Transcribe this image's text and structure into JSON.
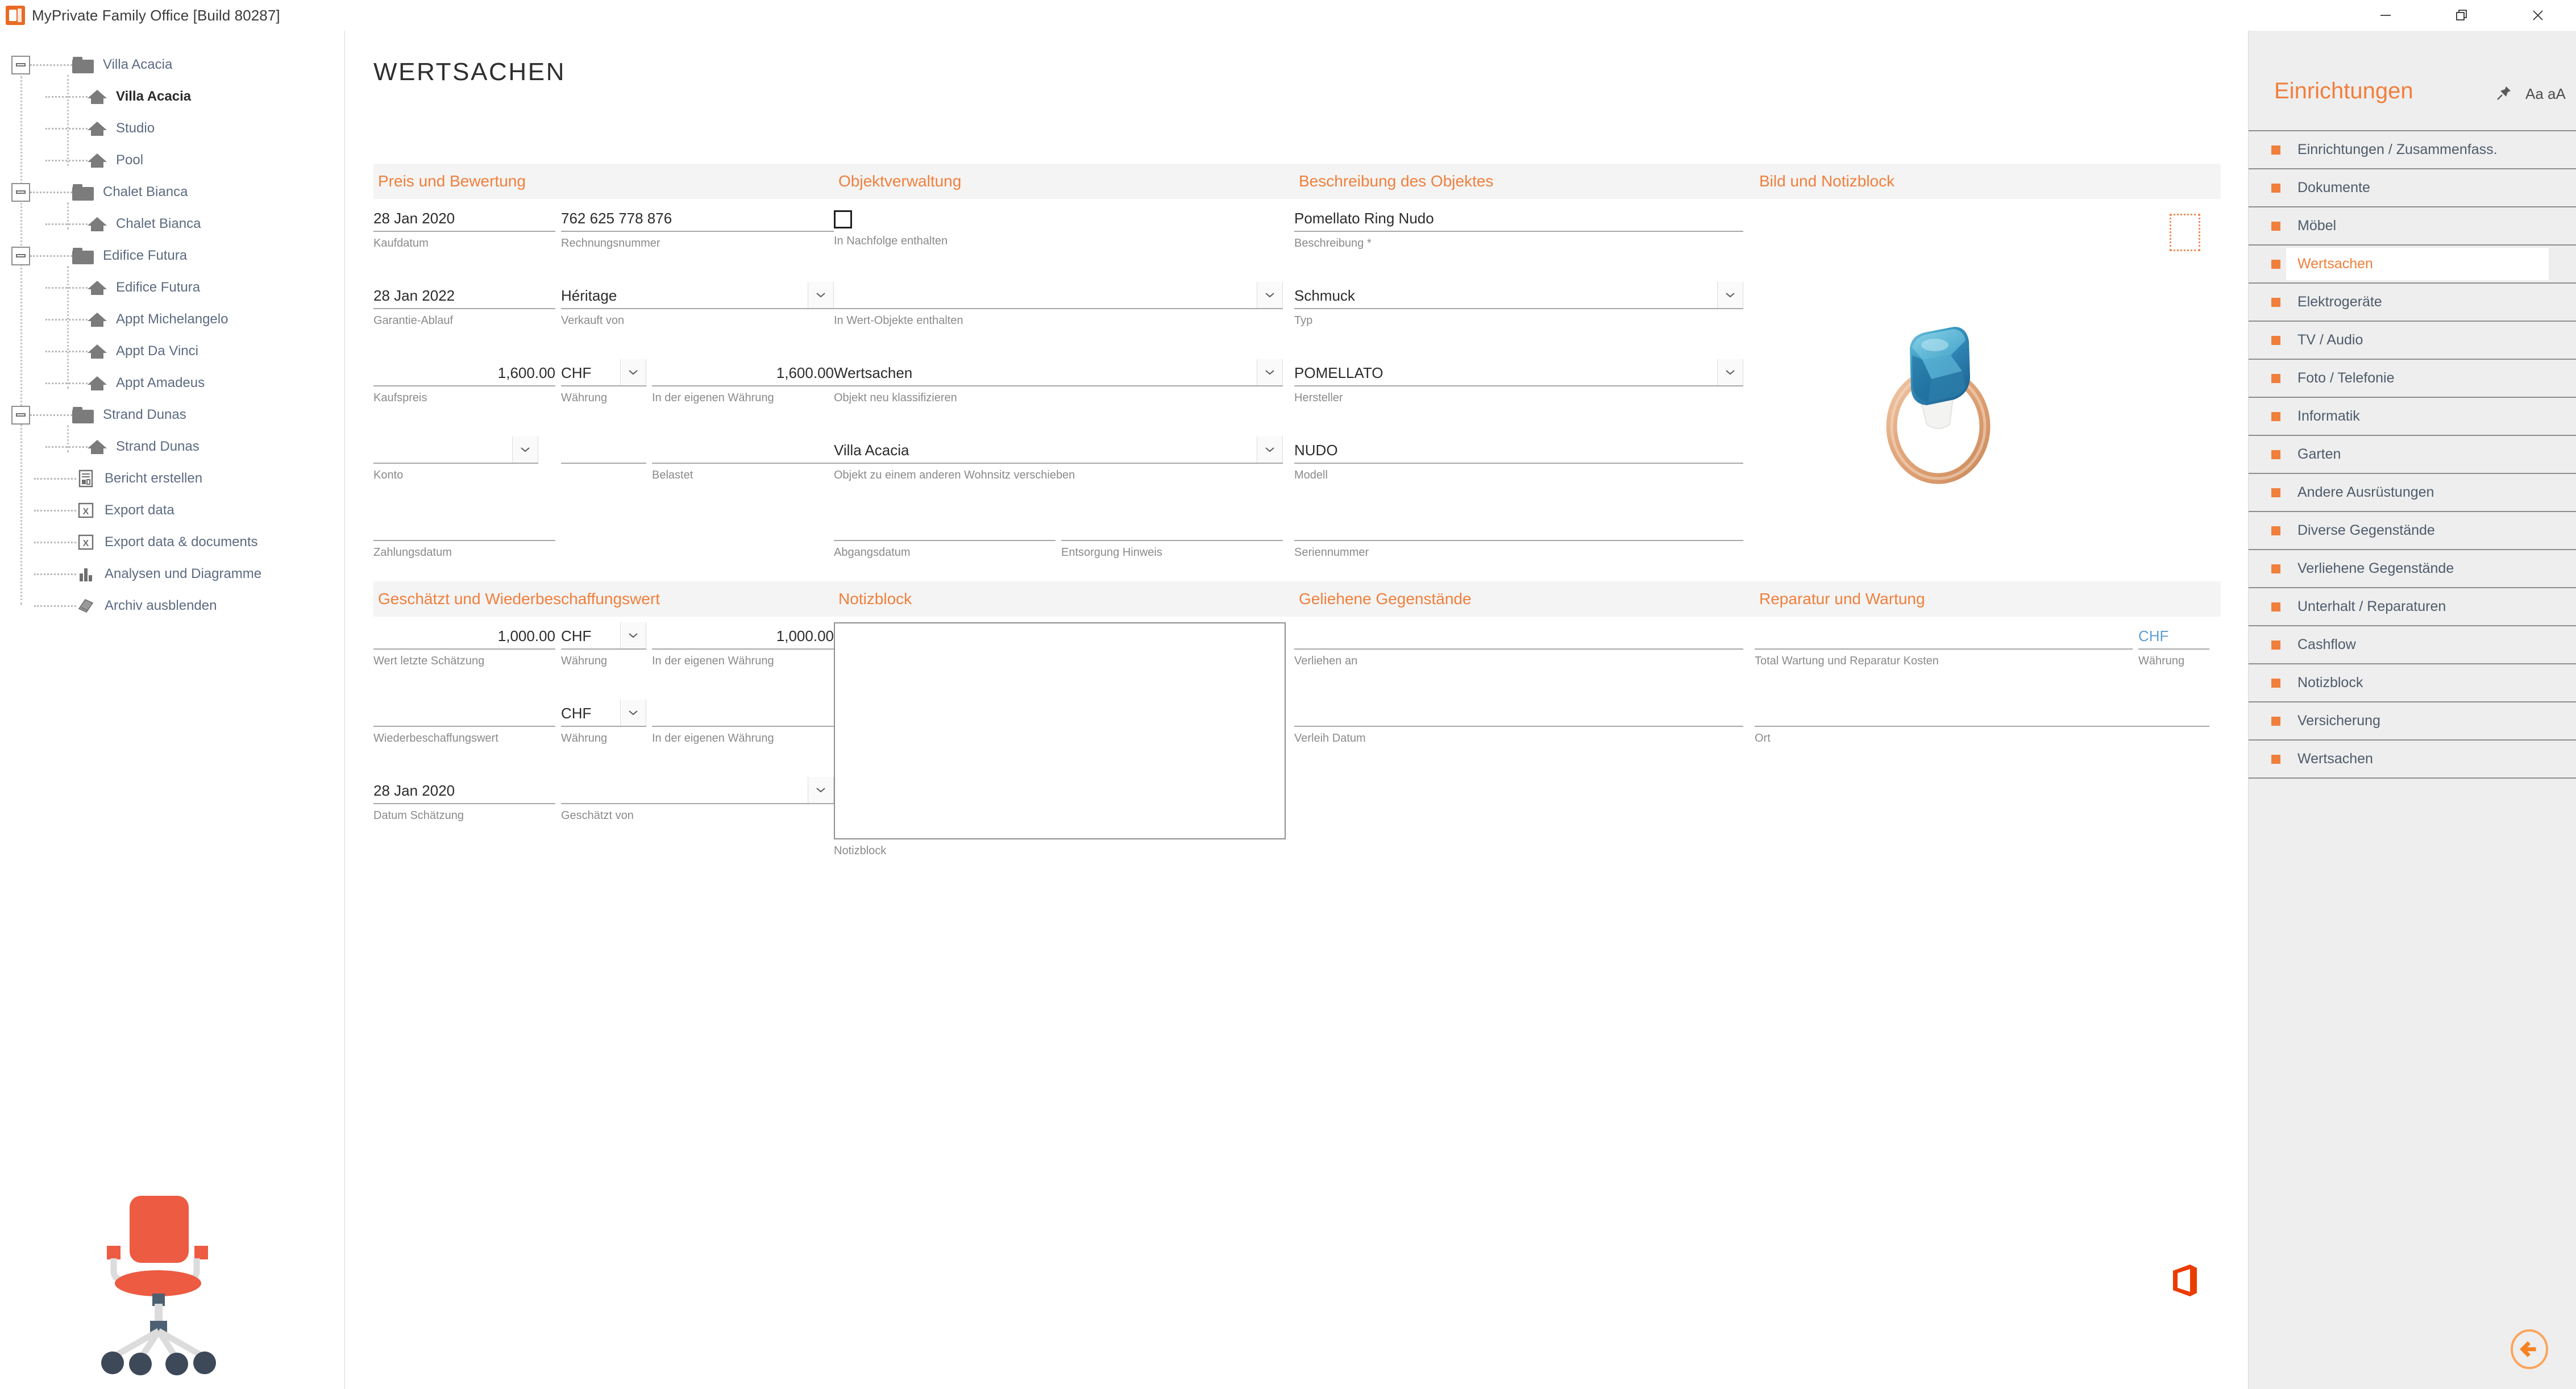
{
  "window": {
    "title": "MyPrivate Family Office [Build 80287]",
    "app_icon": "mp-office-icon",
    "controls": [
      {
        "name": "minimize-button",
        "icon": "minimize-icon"
      },
      {
        "name": "restore-button",
        "icon": "restore-icon"
      },
      {
        "name": "close-button",
        "icon": "close-icon"
      }
    ]
  },
  "sidebar": {
    "groups": [
      {
        "label": "Villa Acacia",
        "icon": "folder-icon",
        "children": [
          {
            "label": "Villa Acacia",
            "icon": "house-icon",
            "selected": true
          },
          {
            "label": "Studio",
            "icon": "house-icon",
            "selected": false
          },
          {
            "label": "Pool",
            "icon": "house-icon",
            "selected": false
          }
        ]
      },
      {
        "label": "Chalet Bianca",
        "icon": "folder-icon",
        "children": [
          {
            "label": "Chalet Bianca",
            "icon": "house-icon",
            "selected": false
          }
        ]
      },
      {
        "label": "Edifice Futura",
        "icon": "folder-icon",
        "children": [
          {
            "label": "Edifice Futura",
            "icon": "house-icon",
            "selected": false
          },
          {
            "label": "Appt Michelangelo",
            "icon": "house-icon",
            "selected": false
          },
          {
            "label": "Appt Da Vinci",
            "icon": "house-icon",
            "selected": false
          },
          {
            "label": "Appt Amadeus",
            "icon": "house-icon",
            "selected": false
          }
        ]
      },
      {
        "label": "Strand Dunas",
        "icon": "folder-icon",
        "children": [
          {
            "label": "Strand Dunas",
            "icon": "house-icon",
            "selected": false
          }
        ]
      }
    ],
    "actions": [
      {
        "label": "Bericht erstellen",
        "icon": "report-icon"
      },
      {
        "label": "Export data",
        "icon": "excel-icon"
      },
      {
        "label": "Export data & documents",
        "icon": "excel-icon"
      },
      {
        "label": "Analysen und Diagramme",
        "icon": "bar-chart-icon"
      },
      {
        "label": "Archiv ausblenden",
        "icon": "archive-icon"
      }
    ],
    "decoration": "office-chair-illustration"
  },
  "main": {
    "page_title": "WERTSACHEN",
    "panels": {
      "preis": {
        "title": "Preis und Bewertung",
        "kaufdatum": {
          "value": "28 Jan 2020",
          "label": "Kaufdatum"
        },
        "rechnungsnummer": {
          "value": "762 625 778 876",
          "label": "Rechnungsnummer"
        },
        "garantie": {
          "value": "28 Jan 2022",
          "label": "Garantie-Ablauf"
        },
        "verkauft_von": {
          "value": "Héritage",
          "label": "Verkauft von"
        },
        "kaufspreis": {
          "value": "1,600.00",
          "label": "Kaufspreis"
        },
        "waehrung": {
          "value": "CHF",
          "label": "Währung"
        },
        "eigene_waehrung": {
          "value": "1,600.00",
          "label": "In der eigenen Währung"
        },
        "konto": {
          "value": "",
          "label": "Konto"
        },
        "mid_empty": {
          "value": "",
          "label": ""
        },
        "belastet": {
          "value": "",
          "label": "Belastet"
        },
        "zahlungsdatum": {
          "value": "",
          "label": "Zahlungsdatum"
        }
      },
      "objekt": {
        "title": "Objektverwaltung",
        "nachfolge": {
          "checked": false,
          "label": "In Nachfolge enthalten"
        },
        "wert_objekte": {
          "value": "",
          "label": "In Wert-Objekte enthalten"
        },
        "klassifizieren": {
          "value": "Wertsachen",
          "label": "Objekt neu klassifizieren"
        },
        "verschieben": {
          "value": "Villa Acacia",
          "label": "Objekt zu einem anderen Wohnsitz verschieben"
        },
        "abgangsdatum": {
          "value": "",
          "label": "Abgangsdatum"
        },
        "entsorgung": {
          "value": "",
          "label": "Entsorgung Hinweis"
        }
      },
      "beschreibung": {
        "title": "Beschreibung des Objektes",
        "beschreibung": {
          "value": "Pomellato Ring Nudo",
          "label": "Beschreibung *"
        },
        "typ": {
          "value": "Schmuck",
          "label": "Typ"
        },
        "hersteller": {
          "value": "POMELLATO",
          "label": "Hersteller"
        },
        "modell": {
          "value": "NUDO",
          "label": "Modell"
        },
        "seriennummer": {
          "value": "",
          "label": "Seriennummer"
        }
      },
      "bild": {
        "title": "Bild und Notizblock",
        "image_alt": "pomellato-nudo-ring-blue-topaz-rose-gold",
        "placeholder_icon": "image-placeholder-icon"
      },
      "geschaetzt": {
        "title": "Geschätzt und Wiederbeschaffungswert",
        "wert_letzte": {
          "value": "1,000.00",
          "label": "Wert letzte Schätzung"
        },
        "waehrung1": {
          "value": "CHF",
          "label": "Währung"
        },
        "eigene1": {
          "value": "1,000.00",
          "label": "In der eigenen Währung"
        },
        "wiederbeschaffung": {
          "value": "",
          "label": "Wiederbeschaffungswert"
        },
        "waehrung2": {
          "value": "CHF",
          "label": "Währung"
        },
        "eigene2": {
          "value": "",
          "label": "In der eigenen Währung"
        },
        "datum_schaetzung": {
          "value": "28 Jan 2020",
          "label": "Datum Schätzung"
        },
        "geschaetzt_von": {
          "value": "",
          "label": "Geschätzt von"
        }
      },
      "notizblock": {
        "title": "Notizblock",
        "value": "",
        "label": "Notizblock"
      },
      "geliehene": {
        "title": "Geliehene Gegenstände",
        "verliehen_an": {
          "value": "",
          "label": "Verliehen an"
        },
        "verleih_datum": {
          "value": "",
          "label": "Verleih Datum"
        }
      },
      "reparatur": {
        "title": "Reparatur und Wartung",
        "total_kosten": {
          "value": "",
          "label": "Total Wartung und Reparatur Kosten"
        },
        "waehrung": {
          "value": "CHF",
          "label": "Währung"
        },
        "ort": {
          "value": "",
          "label": "Ort"
        }
      }
    },
    "office_logo": "office-logo-icon",
    "back_button": "back-arrow-button"
  },
  "rightpanel": {
    "title": "Einrichtungen",
    "pin_icon": "pin-icon",
    "font_size_label": "Aa aA",
    "items": [
      {
        "label": "Einrichtungen / Zusammenfass.",
        "active": false
      },
      {
        "label": "Dokumente",
        "active": false
      },
      {
        "label": "Möbel",
        "active": false
      },
      {
        "label": "Wertsachen",
        "active": true
      },
      {
        "label": "Elektrogeräte",
        "active": false
      },
      {
        "label": "TV / Audio",
        "active": false
      },
      {
        "label": "Foto / Telefonie",
        "active": false
      },
      {
        "label": "Informatik",
        "active": false
      },
      {
        "label": "Garten",
        "active": false
      },
      {
        "label": "Andere Ausrüstungen",
        "active": false
      },
      {
        "label": "Diverse Gegenstände",
        "active": false
      },
      {
        "label": "Verliehene Gegenstände",
        "active": false
      },
      {
        "label": "Unterhalt / Reparaturen",
        "active": false
      },
      {
        "label": "Cashflow",
        "active": false
      },
      {
        "label": "Notizblock",
        "active": false
      },
      {
        "label": "Versicherung",
        "active": false
      },
      {
        "label": "Wertsachen",
        "active": false
      }
    ]
  },
  "colors": {
    "accent": "#f07f3c",
    "panel_head_bg": "#f4f4f4",
    "right_panel_bg": "#eeeeee",
    "label_gray": "#8a8a8a",
    "value_dark": "#2c2c2c",
    "tree_text": "#5c6b80"
  }
}
